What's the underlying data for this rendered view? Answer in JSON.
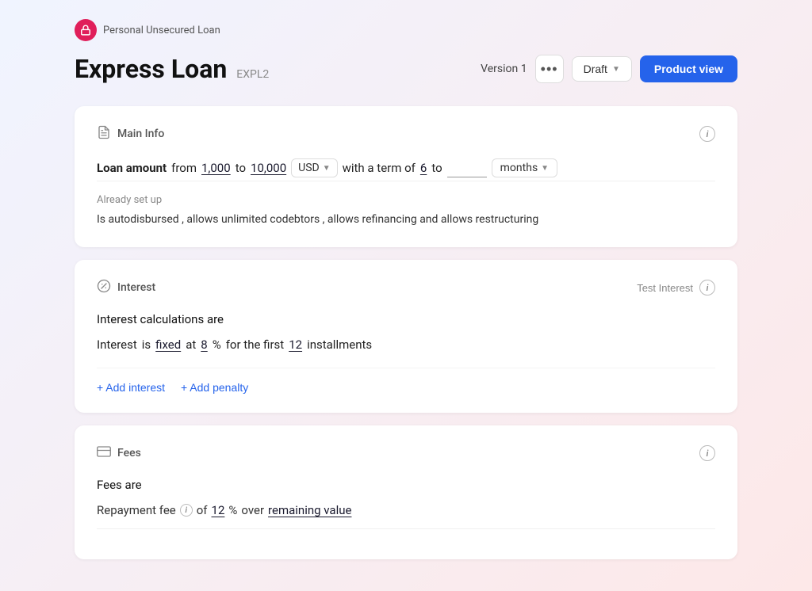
{
  "breadcrumb": {
    "icon_label": "🔒",
    "text": "Personal Unsecured Loan"
  },
  "header": {
    "title": "Express Loan",
    "code": "EXPL2",
    "version": "Version 1",
    "more_icon": "•••",
    "draft_label": "Draft",
    "product_view_label": "Product view"
  },
  "main_info": {
    "card_title": "Main Info",
    "loan_label": "Loan amount",
    "from_label": "from",
    "min_amount": "1,000",
    "to_label": "to",
    "max_amount": "10,000",
    "currency": "USD",
    "with_term_label": "with a term of",
    "term_from": "6",
    "term_to_placeholder": "",
    "months_label": "months",
    "already_setup_label": "Already set up",
    "already_setup_text": "Is autodisbursed , allows unlimited codebtors , allows refinancing and allows restructuring"
  },
  "interest": {
    "card_title": "Interest",
    "test_interest_label": "Test Interest",
    "section_title": "Interest calculations",
    "section_title_suffix": "are",
    "row_text_1": "Interest",
    "row_text_2": "is",
    "fixed_label": "fixed",
    "row_text_3": "at",
    "percent_value": "8",
    "percent_symbol": "%",
    "for_the_first_label": "for the first",
    "installments_count": "12",
    "installments_label": "installments",
    "add_interest_label": "+ Add interest",
    "add_penalty_label": "+ Add penalty"
  },
  "fees": {
    "card_title": "Fees",
    "section_title": "Fees",
    "section_suffix": "are",
    "repayment_fee_label": "Repayment fee",
    "of_label": "of",
    "percent_value": "12",
    "percent_symbol": "%",
    "over_label": "over",
    "remaining_value_label": "remaining value"
  },
  "colors": {
    "accent": "#2563eb",
    "brand_icon_bg": "#e01e5a"
  }
}
